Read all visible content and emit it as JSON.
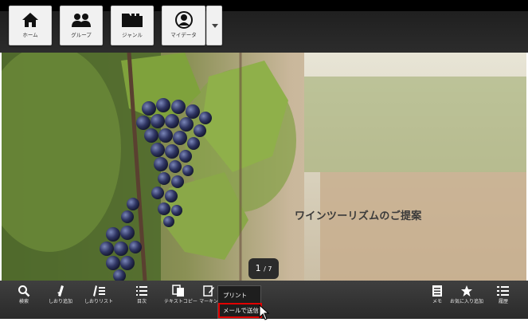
{
  "nav": {
    "home_label": "ホーム",
    "group_label": "グループ",
    "genre_label": "ジャンル",
    "mydata_label": "マイデータ"
  },
  "slide": {
    "title": "ワインツーリズムのご提案",
    "page_current": "1",
    "page_total": "/ 7"
  },
  "toolbar": {
    "search_label": "検索",
    "bookmark_add_label": "しおり追加",
    "bookmark_list_label": "しおりリスト",
    "toc_label": "目次",
    "text_copy_label": "テキストコピー",
    "marking_label": "マーキン",
    "memo_label": "メモ",
    "favorite_add_label": "お気に入り追加",
    "history_label": "履歴"
  },
  "popup_menu": {
    "print_label": "プリント",
    "send_mail_label": "メールで送信"
  },
  "colors": {
    "highlight": "#e00000",
    "toolbar_bg": "#333333",
    "nav_button_bg": "#f1f1f1"
  }
}
